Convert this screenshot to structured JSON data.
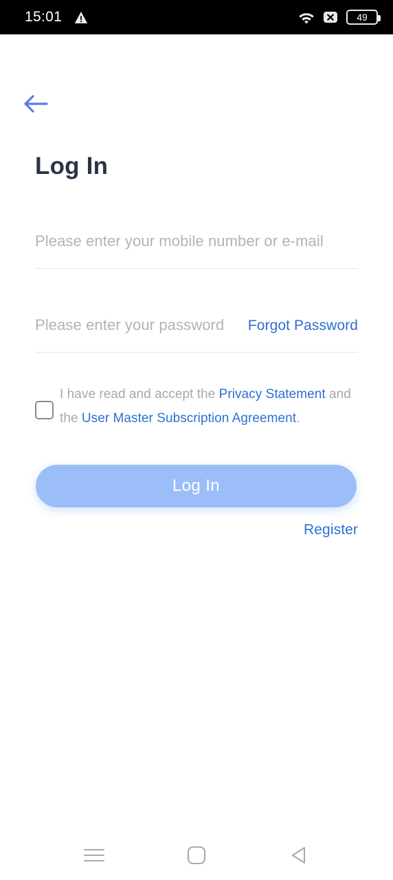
{
  "status_bar": {
    "time": "15:01",
    "warning_icon": "warning-triangle-icon",
    "wifi_icon": "wifi-icon",
    "no_sim_icon": "no-sim-x-icon",
    "battery_level": "49"
  },
  "header": {
    "back_icon": "back-arrow-icon",
    "title": "Log In"
  },
  "form": {
    "account": {
      "value": "",
      "placeholder": "Please enter your mobile number or e-mail"
    },
    "password": {
      "value": "",
      "placeholder": "Please enter your password",
      "forgot_label": "Forgot Password"
    },
    "agreement": {
      "checked": false,
      "prefix": "I have read and accept the ",
      "link1": "Privacy Statement",
      "middle": " and the ",
      "link2": "User Master Subscription Agreement",
      "suffix": "."
    },
    "submit_label": "Log In",
    "register_label": "Register"
  },
  "nav_bar": {
    "recents_icon": "menu-lines-icon",
    "home_icon": "home-square-icon",
    "back_icon": "back-triangle-icon"
  },
  "colors": {
    "accent_blue": "#2f6fd0",
    "arrow_blue": "#5b7be8",
    "button_blue": "#9cbef8",
    "title_navy": "#2b3445",
    "placeholder_gray": "#b3b3b3"
  }
}
